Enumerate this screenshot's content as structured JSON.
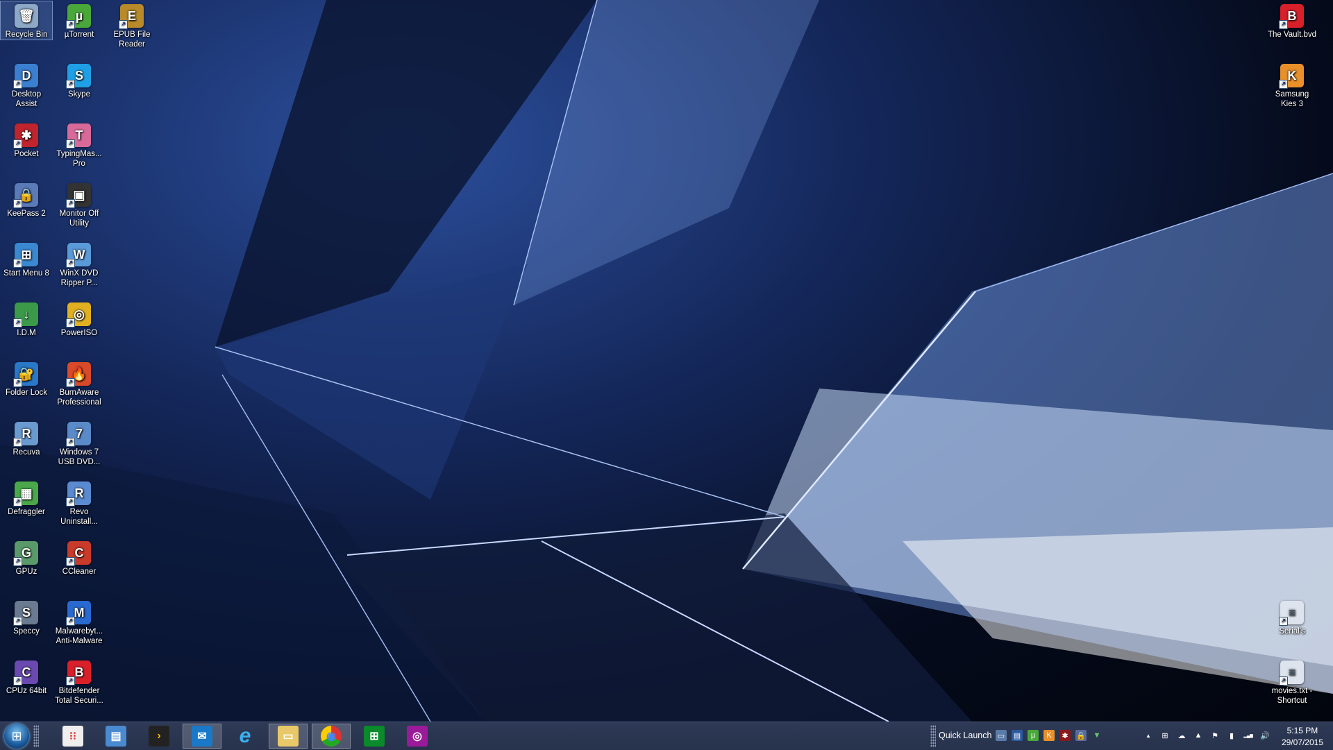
{
  "desktop": {
    "left_icons": [
      {
        "label": "Recycle Bin",
        "icon": "recycle-bin-icon",
        "color": "#8ea8c8",
        "glyph": "🗑",
        "selected": true
      },
      {
        "label": "µTorrent",
        "icon": "utorrent-icon",
        "color": "#4aa83a",
        "glyph": "µ"
      },
      {
        "label": "EPUB File Reader",
        "icon": "epub-reader-icon",
        "color": "#b88a2a",
        "glyph": "E"
      },
      {
        "label": "Desktop Assist",
        "icon": "desktop-assist-icon",
        "color": "#3a7fd0",
        "glyph": "D"
      },
      {
        "label": "Skype",
        "icon": "skype-icon",
        "color": "#1fa0e6",
        "glyph": "S"
      },
      {
        "label": "Pocket",
        "icon": "pocket-icon",
        "color": "#c0242c",
        "glyph": "✱"
      },
      {
        "label": "TypingMas... Pro",
        "icon": "typingmaster-icon",
        "color": "#d86a9a",
        "glyph": "T"
      },
      {
        "label": "KeePass 2",
        "icon": "keepass-icon",
        "color": "#5a7ab8",
        "glyph": "🔒"
      },
      {
        "label": "Monitor Off Utility",
        "icon": "monitor-icon",
        "color": "#333",
        "glyph": "▣"
      },
      {
        "label": "Start Menu 8",
        "icon": "start-menu-icon",
        "color": "#3a88d0",
        "glyph": "⊞"
      },
      {
        "label": "WinX DVD Ripper P...",
        "icon": "winx-dvd-icon",
        "color": "#5a9ad8",
        "glyph": "W"
      },
      {
        "label": "I.D.M",
        "icon": "idm-icon",
        "color": "#3a9a4a",
        "glyph": "↓"
      },
      {
        "label": "PowerISO",
        "icon": "poweriso-icon",
        "color": "#e0b020",
        "glyph": "◎"
      },
      {
        "label": "Folder Lock",
        "icon": "folder-lock-icon",
        "color": "#2a78c8",
        "glyph": "🔐"
      },
      {
        "label": "BurnAware Professional",
        "icon": "burnaware-icon",
        "color": "#d84a2a",
        "glyph": "🔥"
      },
      {
        "label": "Recuva",
        "icon": "recuva-icon",
        "color": "#6a9ad0",
        "glyph": "R"
      },
      {
        "label": "Windows 7 USB DVD...",
        "icon": "win7-usb-icon",
        "color": "#5a8ac8",
        "glyph": "7"
      },
      {
        "label": "Defraggler",
        "icon": "defraggler-icon",
        "color": "#4aa84a",
        "glyph": "▦"
      },
      {
        "label": "Revo Uninstall...",
        "icon": "revo-icon",
        "color": "#5a8ad0",
        "glyph": "R"
      },
      {
        "label": "GPUz",
        "icon": "gpuz-icon",
        "color": "#5a9a6a",
        "glyph": "G"
      },
      {
        "label": "CCleaner",
        "icon": "ccleaner-icon",
        "color": "#c83a2a",
        "glyph": "C"
      },
      {
        "label": "Speccy",
        "icon": "speccy-icon",
        "color": "#6a7a90",
        "glyph": "S"
      },
      {
        "label": "Malwarebyt... Anti-Malware",
        "icon": "malwarebytes-icon",
        "color": "#2a6ad0",
        "glyph": "M"
      },
      {
        "label": "CPUz 64bit",
        "icon": "cpuz-icon",
        "color": "#6a4ab0",
        "glyph": "C"
      },
      {
        "label": "Bitdefender Total Securi...",
        "icon": "bitdefender-icon",
        "color": "#d8202a",
        "glyph": "B"
      }
    ],
    "right_icons": [
      {
        "label": "The Vault.bvd",
        "icon": "bitdefender-vault-icon",
        "color": "#d8202a",
        "glyph": "B"
      },
      {
        "label": "Samsung Kies 3",
        "icon": "samsung-kies-icon",
        "color": "#e8902a",
        "glyph": "K"
      },
      {
        "label": "Serial's",
        "icon": "text-file-icon",
        "color": "#dde4ee",
        "glyph": "≡"
      },
      {
        "label": "movies.txt - Shortcut",
        "icon": "text-file-icon",
        "color": "#dde4ee",
        "glyph": "≡"
      }
    ]
  },
  "taskbar": {
    "pinned": [
      {
        "name": "apps-icon",
        "color": "#eee",
        "glyph": "⁝⁝",
        "active": false
      },
      {
        "name": "control-panel-icon",
        "color": "#4a8ad0",
        "glyph": "▤",
        "active": false
      },
      {
        "name": "plex-icon",
        "color": "#222",
        "glyph": "›",
        "active": false
      },
      {
        "name": "mail-icon",
        "color": "#1a78c8",
        "glyph": "✉",
        "active": true
      },
      {
        "name": "internet-explorer-icon",
        "color": "transparent",
        "glyph": "e",
        "active": false
      },
      {
        "name": "file-explorer-icon",
        "color": "#e8c868",
        "glyph": "▭",
        "active": true
      },
      {
        "name": "chrome-icon",
        "color": "transparent",
        "glyph": "◉",
        "active": true
      },
      {
        "name": "store-icon",
        "color": "#0a8a2a",
        "glyph": "⊞",
        "active": false
      },
      {
        "name": "camera-icon",
        "color": "#9a1a9a",
        "glyph": "◎",
        "active": false
      }
    ],
    "quick_launch_label": "Quick Launch",
    "quick_launch": [
      {
        "name": "show-desktop-icon",
        "color": "#5a7aa8",
        "glyph": "▭"
      },
      {
        "name": "switch-windows-icon",
        "color": "#2a5aa0",
        "glyph": "▤"
      },
      {
        "name": "utorrent-icon",
        "color": "#4aa83a",
        "glyph": "µ"
      },
      {
        "name": "samsung-kies-icon",
        "color": "#e8902a",
        "glyph": "K"
      },
      {
        "name": "pocket-icon",
        "color": "#8a1a1a",
        "glyph": "✱"
      },
      {
        "name": "keepass-icon",
        "color": "#5a6a9a",
        "glyph": "🔒"
      },
      {
        "name": "expand-icon",
        "color": "transparent",
        "glyph": "▼"
      }
    ],
    "tray": [
      {
        "name": "show-hidden-icon",
        "glyph": "▲"
      },
      {
        "name": "windows-icon",
        "glyph": "⊞"
      },
      {
        "name": "onedrive-icon",
        "glyph": "☁"
      },
      {
        "name": "google-drive-icon",
        "glyph": "▲"
      },
      {
        "name": "action-center-icon",
        "glyph": "⚑"
      },
      {
        "name": "battery-icon",
        "glyph": "▮"
      },
      {
        "name": "signal-icon",
        "glyph": "▂▄▆"
      },
      {
        "name": "volume-icon",
        "glyph": "🔊"
      }
    ],
    "time": "5:15 PM",
    "date": "29/07/2015"
  }
}
